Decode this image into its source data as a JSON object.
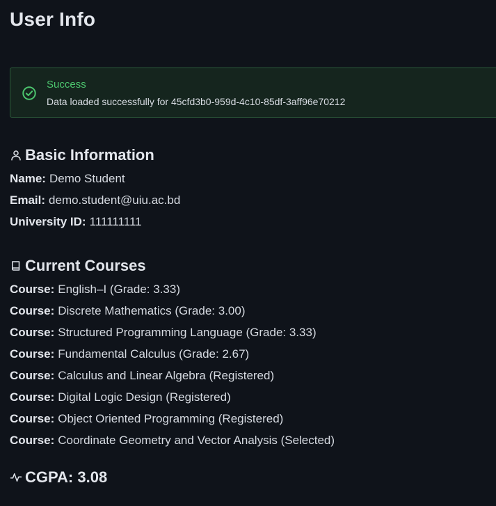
{
  "page": {
    "title": "User Info"
  },
  "alert": {
    "title": "Success",
    "message": "Data loaded successfully for 45cfd3b0-959d-4c10-85df-3aff96e70212",
    "icon": "check-circle-icon",
    "color": "#4cc56e"
  },
  "basic_info": {
    "heading": "Basic Information",
    "icon": "user-icon",
    "name_label": "Name:",
    "name_value": "Demo Student",
    "email_label": "Email:",
    "email_value": "demo.student@uiu.ac.bd",
    "id_label": "University ID:",
    "id_value": "111111111"
  },
  "courses": {
    "heading": "Current Courses",
    "icon": "book-icon",
    "items": [
      {
        "label": "Course:",
        "value": "English–I (Grade: 3.33)"
      },
      {
        "label": "Course:",
        "value": "Discrete Mathematics (Grade: 3.00)"
      },
      {
        "label": "Course:",
        "value": "Structured Programming Language (Grade: 3.33)"
      },
      {
        "label": "Course:",
        "value": "Fundamental Calculus (Grade: 2.67)"
      },
      {
        "label": "Course:",
        "value": "Calculus and Linear Algebra (Registered)"
      },
      {
        "label": "Course:",
        "value": "Digital Logic Design (Registered)"
      },
      {
        "label": "Course:",
        "value": "Object Oriented Programming (Registered)"
      },
      {
        "label": "Course:",
        "value": "Coordinate Geometry and Vector Analysis (Selected)"
      }
    ]
  },
  "cgpa": {
    "heading": "CGPA: 3.08",
    "icon": "activity-icon"
  }
}
